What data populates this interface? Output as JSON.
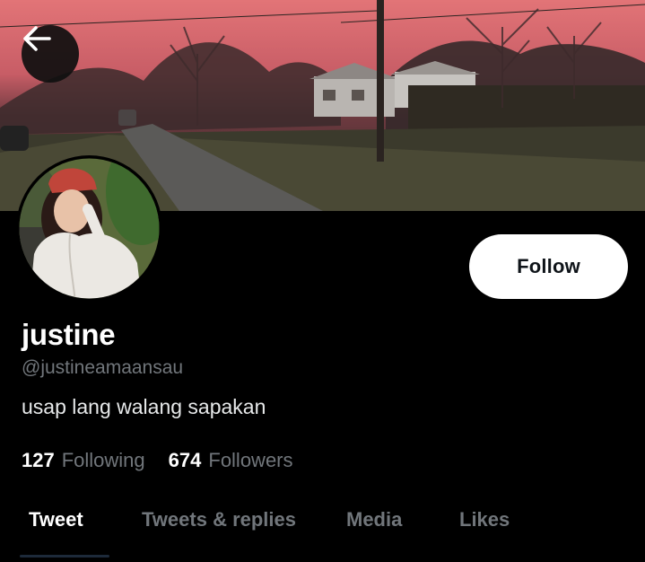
{
  "header": {
    "back_icon": "arrow-left-icon"
  },
  "profile": {
    "display_name": "justine",
    "handle": "@justineamaansau",
    "bio": "usap lang walang sapakan",
    "follow_label": "Follow",
    "following_count": "127",
    "following_label": "Following",
    "followers_count": "674",
    "followers_label": "Followers"
  },
  "tabs": [
    {
      "label": "Tweet",
      "active": true
    },
    {
      "label": "Tweets & replies",
      "active": false
    },
    {
      "label": "Media",
      "active": false
    },
    {
      "label": "Likes",
      "active": false
    }
  ],
  "colors": {
    "background": "#000000",
    "follow_button_bg": "#ffffff",
    "secondary_text": "#71767b",
    "primary_text": "#ffffff"
  }
}
